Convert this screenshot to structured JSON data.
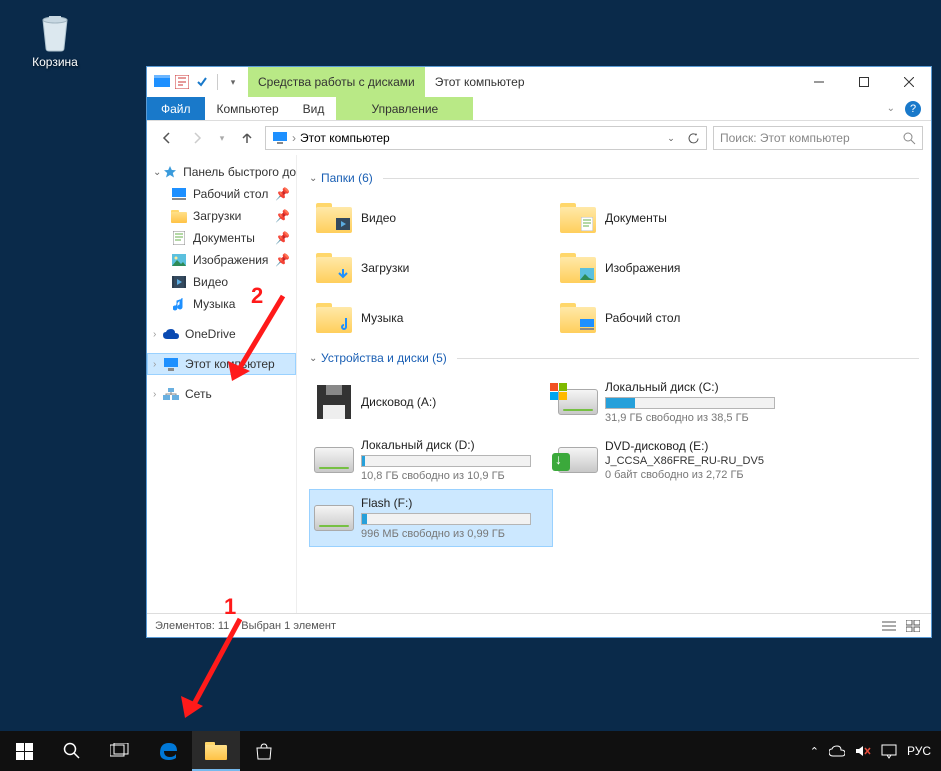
{
  "desktop": {
    "recycle_bin": "Корзина"
  },
  "window": {
    "qat_tool_label": "Средства работы с дисками",
    "title": "Этот компьютер",
    "ribbon": {
      "file": "Файл",
      "computer": "Компьютер",
      "view": "Вид",
      "drive_tools": "Управление"
    },
    "address": {
      "path": "Этот компьютер",
      "search_placeholder": "Поиск: Этот компьютер"
    }
  },
  "sidebar": {
    "quick_access": "Панель быстрого до",
    "items": [
      {
        "label": "Рабочий стол",
        "pinned": true
      },
      {
        "label": "Загрузки",
        "pinned": true
      },
      {
        "label": "Документы",
        "pinned": true
      },
      {
        "label": "Изображения",
        "pinned": true
      },
      {
        "label": "Видео",
        "pinned": false
      },
      {
        "label": "Музыка",
        "pinned": false
      }
    ],
    "onedrive": "OneDrive",
    "this_pc": "Этот компьютер",
    "network": "Сеть"
  },
  "content": {
    "folders_header": "Папки (6)",
    "folders": [
      {
        "label": "Видео"
      },
      {
        "label": "Документы"
      },
      {
        "label": "Загрузки"
      },
      {
        "label": "Изображения"
      },
      {
        "label": "Музыка"
      },
      {
        "label": "Рабочий стол"
      }
    ],
    "drives_header": "Устройства и диски (5)",
    "drives": [
      {
        "label": "Дисковод (A:)",
        "sub": "",
        "type": "floppy",
        "fill": 0
      },
      {
        "label": "Локальный диск (C:)",
        "sub": "31,9 ГБ свободно из 38,5 ГБ",
        "type": "os",
        "fill": 17
      },
      {
        "label": "Локальный диск (D:)",
        "sub": "10,8 ГБ свободно из 10,9 ГБ",
        "type": "hdd",
        "fill": 2
      },
      {
        "label": "DVD-дисковод (E:)",
        "sub2": "J_CCSA_X86FRE_RU-RU_DV5",
        "sub": "0 байт свободно из 2,72 ГБ",
        "type": "dvd"
      },
      {
        "label": "Flash (F:)",
        "sub": "996 МБ свободно из 0,99 ГБ",
        "type": "hdd",
        "fill": 3,
        "selected": true
      }
    ]
  },
  "status": {
    "items": "Элементов: 11",
    "selected": "Выбран 1 элемент"
  },
  "annotations": {
    "n1": "1",
    "n2": "2"
  },
  "taskbar": {
    "lang": "РУС"
  }
}
